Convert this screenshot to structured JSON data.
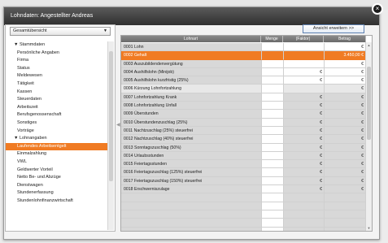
{
  "window": {
    "title": "Lohndaten: Angestellter Andreas",
    "close_glyph": "×"
  },
  "sidebar": {
    "view_select": {
      "value": "Gesamtübersicht",
      "arrow": "▼"
    },
    "tree": [
      {
        "label": "▼ Stammdaten",
        "kind": "group"
      },
      {
        "label": "Persönliche Angaben",
        "kind": "child"
      },
      {
        "label": "Firma",
        "kind": "child"
      },
      {
        "label": "Status",
        "kind": "child"
      },
      {
        "label": "Meldewesen",
        "kind": "child"
      },
      {
        "label": "Tätigkeit",
        "kind": "child"
      },
      {
        "label": "Kassen",
        "kind": "child"
      },
      {
        "label": "Steuerdaten",
        "kind": "child"
      },
      {
        "label": "Arbeitszeit",
        "kind": "child"
      },
      {
        "label": "Berufsgenossenschaft",
        "kind": "child"
      },
      {
        "label": "Sonstiges",
        "kind": "child"
      },
      {
        "label": "Vorträge",
        "kind": "child"
      },
      {
        "label": "▼ Lohnangaben",
        "kind": "group"
      },
      {
        "label": "Laufendes Arbeitsentgelt",
        "kind": "child",
        "selected": true
      },
      {
        "label": "Einmalzahlung",
        "kind": "child"
      },
      {
        "label": "VWL",
        "kind": "child"
      },
      {
        "label": "Geldwerter Vorteil",
        "kind": "child"
      },
      {
        "label": "Netto Be- und Abzüge",
        "kind": "child"
      },
      {
        "label": "Dienstwagen",
        "kind": "child"
      },
      {
        "label": "Stundenerfassung",
        "kind": "child"
      },
      {
        "label": "Stundenlohnfinanzwirtschaft",
        "kind": "child"
      }
    ]
  },
  "toolbar": {
    "expand_view_label": "Ansicht erweitern >>"
  },
  "grid": {
    "columns": [
      "Lohnart",
      "Menge",
      "(Faktor)",
      "Betrag"
    ],
    "rows": [
      {
        "lohnart": "0001 Lohn",
        "faktor": "",
        "betrag": "€",
        "style": "white"
      },
      {
        "lohnart": "0002 Gehalt",
        "faktor": "",
        "betrag": "3.450,00 €",
        "style": "sel"
      },
      {
        "lohnart": "0003 Auszubildendenvergütung",
        "faktor": "",
        "betrag": "€",
        "style": "white"
      },
      {
        "lohnart": "0004 Aushilfslohn (Minijob)",
        "faktor": "€",
        "betrag": "€",
        "style": "white"
      },
      {
        "lohnart": "0005 Aushilfslohn kurzfristig (25%)",
        "faktor": "€",
        "betrag": "€",
        "style": "white"
      },
      {
        "lohnart": "0006 Kürzung Lohnfortzahlung",
        "faktor": "",
        "betrag": "€",
        "style": "alt"
      },
      {
        "lohnart": "0007 Lohnfortzahlung Krank",
        "faktor": "€",
        "betrag": "€",
        "style": ""
      },
      {
        "lohnart": "0008 Lohnfortzahlung Unfall",
        "faktor": "€",
        "betrag": "€",
        "style": ""
      },
      {
        "lohnart": "0009 Überstunden",
        "faktor": "€",
        "betrag": "€",
        "style": ""
      },
      {
        "lohnart": "0010 Überstundenzuschlag (25%)",
        "faktor": "€",
        "betrag": "€",
        "style": ""
      },
      {
        "lohnart": "0011 Nachtzuschlag (25%) steuerfrei",
        "faktor": "€",
        "betrag": "€",
        "style": ""
      },
      {
        "lohnart": "0012 Nachtzuschlag (40%) steuerfrei",
        "faktor": "€",
        "betrag": "€",
        "style": ""
      },
      {
        "lohnart": "0013 Sonntagszuschlag (50%)",
        "faktor": "€",
        "betrag": "€",
        "style": ""
      },
      {
        "lohnart": "0014 Urlaubsstunden",
        "faktor": "€",
        "betrag": "€",
        "style": ""
      },
      {
        "lohnart": "0015 Feiertagsstunden",
        "faktor": "€",
        "betrag": "€",
        "style": ""
      },
      {
        "lohnart": "0016 Feiertagszuschlag (125%) steuerfrei",
        "faktor": "€",
        "betrag": "€",
        "style": ""
      },
      {
        "lohnart": "0017 Feiertagszuschlag (150%) steuerfrei",
        "faktor": "€",
        "betrag": "€",
        "style": ""
      },
      {
        "lohnart": "0018 Erschwerniszulage",
        "faktor": "€",
        "betrag": "€",
        "style": ""
      },
      {
        "lohnart": "",
        "faktor": "",
        "betrag": "",
        "style": ""
      },
      {
        "lohnart": "",
        "faktor": "",
        "betrag": "",
        "style": ""
      },
      {
        "lohnart": "",
        "faktor": "",
        "betrag": "",
        "style": ""
      },
      {
        "lohnart": "",
        "faktor": "",
        "betrag": "",
        "style": ""
      },
      {
        "lohnart": "",
        "faktor": "",
        "betrag": "",
        "style": ""
      }
    ]
  },
  "icons": {
    "splitter": "◀",
    "scroll_up": "▲",
    "scroll_down": "▼"
  }
}
